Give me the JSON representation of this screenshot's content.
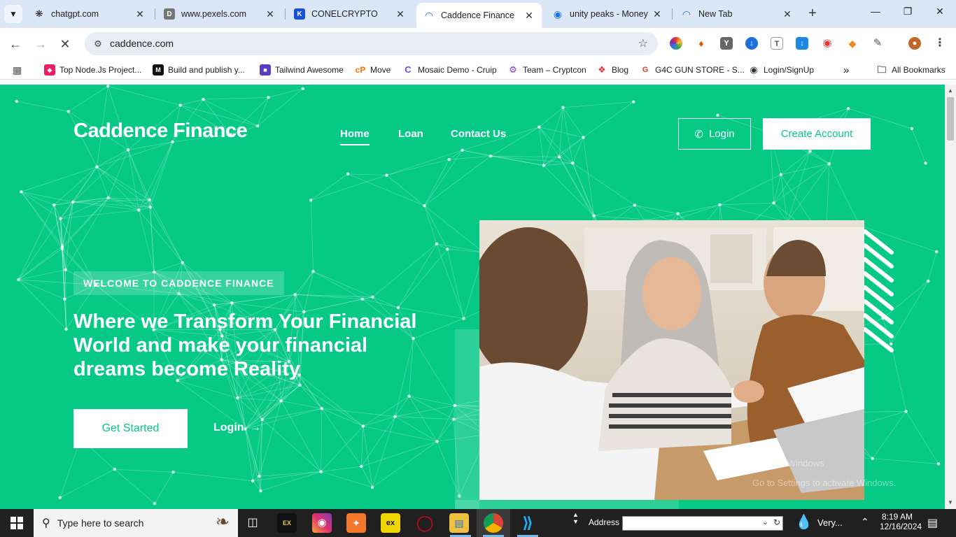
{
  "browser": {
    "tabs": [
      {
        "title": "chatgpt.com",
        "icon": "openai-icon",
        "active": false
      },
      {
        "title": "www.pexels.com",
        "icon": "pexels-icon",
        "active": false
      },
      {
        "title": "CONELCRYPTO",
        "icon": "conel-icon",
        "active": false
      },
      {
        "title": "Caddence Finance",
        "icon": "loading-icon",
        "active": true
      },
      {
        "title": "unity peaks - Money",
        "icon": "unity-icon",
        "active": false
      },
      {
        "title": "New Tab",
        "icon": "loading-icon",
        "active": false
      }
    ],
    "url": "caddence.com",
    "bookmarks": [
      "Top Node.Js Project...",
      "Build and publish y...",
      "Tailwind Awesome",
      "Move",
      "Mosaic Demo - Cruip",
      "Team – Cryptcon",
      "Blog",
      "G4C GUN STORE - S...",
      "Login/SignUp"
    ],
    "all_bookmarks": "All Bookmarks",
    "overflow": "»"
  },
  "page": {
    "brand": "Caddence Finance",
    "nav": [
      "Home",
      "Loan",
      "Contact Us"
    ],
    "login_button": "Login",
    "create_account_button": "Create Account",
    "welcome": "WELCOME TO CADDENCE FINANCE",
    "headline_line1": "Where we Transform Your Financial",
    "headline_line2": "World and make your financial",
    "headline_line3": "dreams become Reality",
    "get_started": "Get Started",
    "login_link": "Login",
    "watermark_line1": "Activate Windows",
    "watermark_line2": "Go to Settings to activate Windows.",
    "accent_color": "#06c986"
  },
  "taskbar": {
    "search_placeholder": "Type here to search",
    "address_label": "Address",
    "weather": "Very...",
    "time": "8:19 AM",
    "date": "12/16/2024"
  }
}
